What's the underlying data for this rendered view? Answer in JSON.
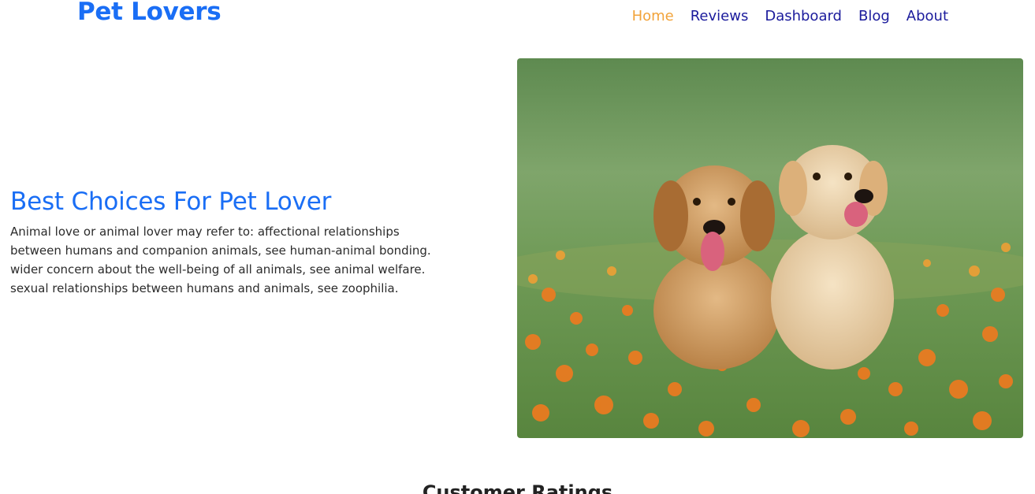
{
  "header": {
    "brand": "Pet Lovers",
    "nav": [
      {
        "label": "Home",
        "active": true
      },
      {
        "label": "Reviews",
        "active": false
      },
      {
        "label": "Dashboard",
        "active": false
      },
      {
        "label": "Blog",
        "active": false
      },
      {
        "label": "About",
        "active": false
      }
    ]
  },
  "hero": {
    "title": "Best Choices For Pet Lover",
    "description": "Animal love or animal lover may refer to: affectional relationships between humans and companion animals, see human-animal bonding. wider concern about the well-being of all animals, see animal welfare. sexual relationships between humans and animals, see zoophilia.",
    "image_icon": "two-puppies-photo"
  },
  "ratings_section": {
    "title": "Customer Ratings"
  },
  "colors": {
    "brand": "#1a6ef5",
    "nav_link": "#1b1b9c",
    "nav_active": "#f2a33a"
  }
}
